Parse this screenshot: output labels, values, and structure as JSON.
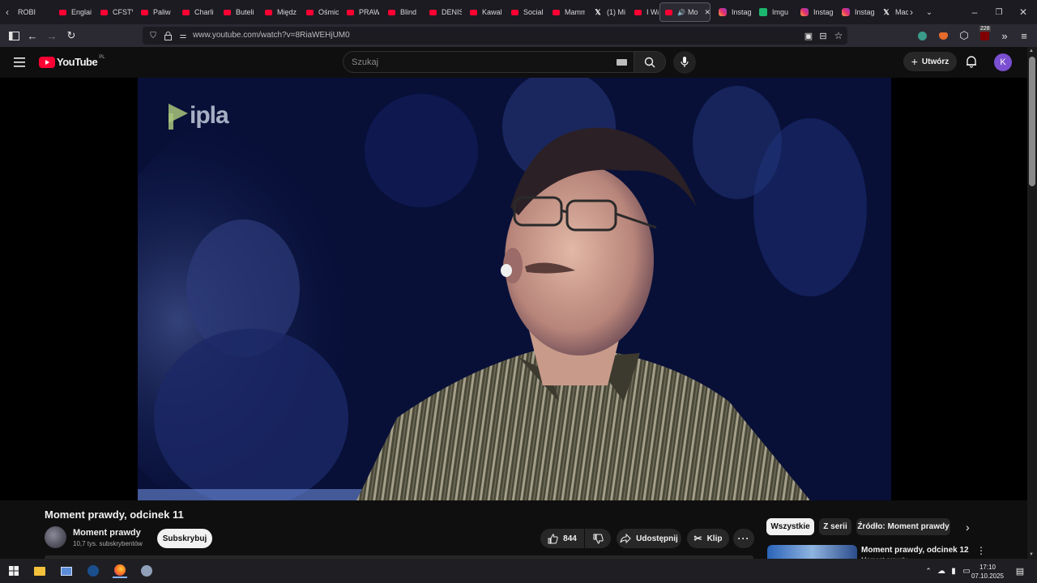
{
  "browser": {
    "tabs": [
      {
        "label": "ROBI",
        "icon": "none"
      },
      {
        "label": "Englai",
        "icon": "youtube"
      },
      {
        "label": "CFSTV",
        "icon": "youtube"
      },
      {
        "label": "Paliw",
        "icon": "youtube"
      },
      {
        "label": "Charli",
        "icon": "youtube"
      },
      {
        "label": "Buteli",
        "icon": "youtube"
      },
      {
        "label": "Międz",
        "icon": "youtube"
      },
      {
        "label": "Ośmic",
        "icon": "youtube"
      },
      {
        "label": "PRAW",
        "icon": "youtube"
      },
      {
        "label": "Blind",
        "icon": "youtube"
      },
      {
        "label": "DENIS",
        "icon": "youtube"
      },
      {
        "label": "Kawal",
        "icon": "youtube"
      },
      {
        "label": "Social",
        "icon": "youtube"
      },
      {
        "label": "Mamm",
        "icon": "youtube"
      },
      {
        "label": "(1) Mi",
        "icon": "x"
      },
      {
        "label": "I Walk",
        "icon": "youtube"
      },
      {
        "label": "Mo",
        "icon": "youtube",
        "active": true
      },
      {
        "label": "Instag",
        "icon": "instagram"
      },
      {
        "label": "Imgu",
        "icon": "imgur"
      },
      {
        "label": "Instag",
        "icon": "instagram"
      },
      {
        "label": "Instag",
        "icon": "instagram"
      },
      {
        "label": "Mac",
        "icon": "x"
      }
    ],
    "url": "www.youtube.com/watch?v=8RiaWEHjUM0",
    "badge_count": "228"
  },
  "youtube": {
    "logo_text": "YouTube",
    "region": "PL",
    "search_placeholder": "Szukaj",
    "create_label": "Utwórz",
    "avatar_letter": "K"
  },
  "video": {
    "watermark": "ipla",
    "title": "Moment prawdy, odcinek 11",
    "channel_name": "Moment prawdy",
    "channel_subs": "10,7 tys. subskrybentów",
    "subscribe_label": "Subskrybuj",
    "likes": "844",
    "share_label": "Udostępnij",
    "clip_label": "Klip"
  },
  "sidebar": {
    "chips": [
      "Wszystkie",
      "Z serii",
      "Źródło: Moment prawdy"
    ],
    "related_title": "Moment prawdy, odcinek 12",
    "related_channel": "Moment prawdy"
  },
  "taskbar": {
    "time": "17:10",
    "date": "07.10.2025"
  }
}
